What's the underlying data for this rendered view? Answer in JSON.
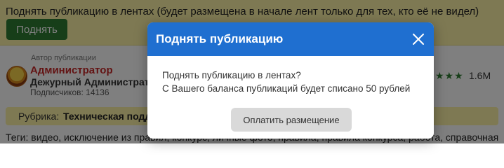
{
  "promo": {
    "text": "Поднять публикацию в лентах (будет размещена в начале лент только для тех, кто её не видел)",
    "button_label": "Поднять"
  },
  "author": {
    "caption": "Автор публикации",
    "name": "Администратор",
    "role": "Дежурный Администратор",
    "subscribers": "Подписчиков: 14136",
    "rating_stars": "★★★",
    "views": "1.6M"
  },
  "category": {
    "label": "Рубрика:",
    "value": "Техническая поддержка"
  },
  "tags": {
    "text": "Теги: видео, исключение из правил, конкурс, личные фото, правила, правила конкурса, работа, справочная"
  },
  "modal": {
    "title": "Поднять публикацию",
    "line1": "Поднять публикацию в лентах?",
    "line2": "С Вашего баланса публикаций будет списано 50 рублей",
    "pay_button": "Оплатить размещение"
  },
  "colors": {
    "promo_bg": "#fdf3a6",
    "promo_button": "#2e7d32",
    "modal_header": "#1f6fd0",
    "author_name": "#c62828",
    "pay_button_bg": "#d9d9d9"
  },
  "icons": {
    "close": "close-icon",
    "avatar": "avatar"
  }
}
